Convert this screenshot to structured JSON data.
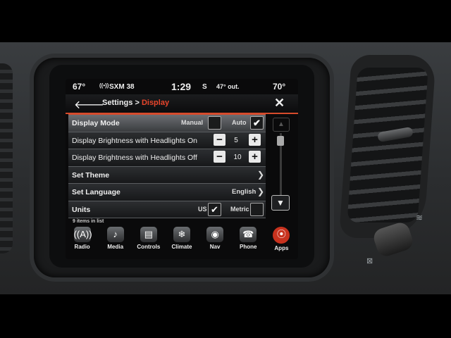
{
  "status": {
    "temp_left": "67°",
    "radio": "SXM 38",
    "time": "1:29",
    "compass": "S",
    "outside_temp": "47° out.",
    "temp_right": "70°"
  },
  "header": {
    "breadcrumb_parent": "Settings >",
    "breadcrumb_current": "Display"
  },
  "rows": {
    "display_mode": {
      "label": "Display Mode",
      "manual": "Manual",
      "auto": "Auto"
    },
    "brightness_on": {
      "label": "Display Brightness with Headlights On",
      "value": "5"
    },
    "brightness_off": {
      "label": "Display Brightness with Headlights Off",
      "value": "10"
    },
    "set_theme": {
      "label": "Set Theme"
    },
    "set_language": {
      "label": "Set Language",
      "value": "English"
    },
    "units": {
      "label": "Units",
      "us": "US",
      "metric": "Metric"
    }
  },
  "list_count": "9 items in list",
  "apps": [
    {
      "label": "Radio",
      "icon": "radio-icon"
    },
    {
      "label": "Media",
      "icon": "media-icon"
    },
    {
      "label": "Controls",
      "icon": "controls-icon"
    },
    {
      "label": "Climate",
      "icon": "climate-icon"
    },
    {
      "label": "Nav",
      "icon": "nav-icon"
    },
    {
      "label": "Phone",
      "icon": "phone-icon"
    },
    {
      "label": "Apps",
      "icon": "apps-icon"
    }
  ],
  "colors": {
    "accent": "#e8452b",
    "background": "#0a0a0b"
  }
}
